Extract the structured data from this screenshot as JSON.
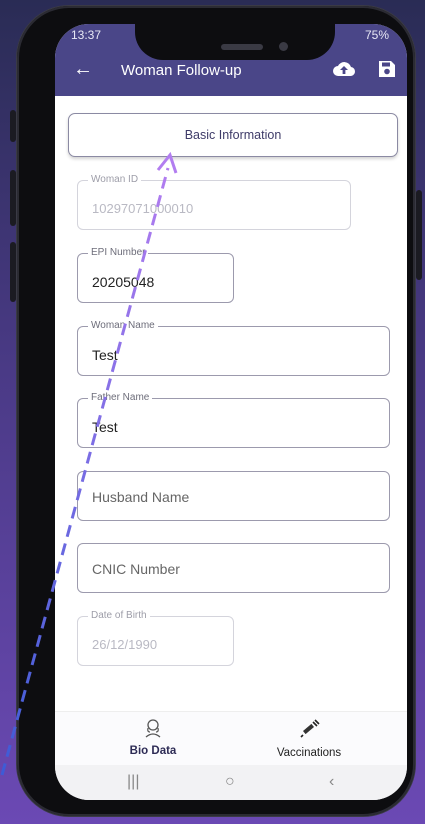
{
  "status_bar": {
    "time": "13:37",
    "battery": "75%"
  },
  "header": {
    "title": "Woman Follow-up"
  },
  "section_button": {
    "label": "Basic Information"
  },
  "fields": {
    "woman_id": {
      "label": "Woman ID",
      "value": "10297071000010",
      "disabled": true
    },
    "epi_number": {
      "label": "EPI Number",
      "value": "20205048"
    },
    "woman_name": {
      "label": "Woman Name",
      "value": "Test"
    },
    "father_name": {
      "label": "Father Name",
      "value": "Test"
    },
    "husband_name": {
      "placeholder": "Husband Name"
    },
    "cnic_number": {
      "placeholder": "CNIC Number"
    },
    "date_of_birth": {
      "label": "Date of Birth",
      "value": "26/12/1990",
      "disabled": true
    }
  },
  "bottom_nav": {
    "bio_data": {
      "label": "Bio Data",
      "icon": "woman-profile-icon",
      "active": true
    },
    "vaccinations": {
      "label": "Vaccinations",
      "icon": "syringe-icon"
    }
  },
  "colors": {
    "header": "#4a4688",
    "accent": "#3e3b68",
    "arrow_start": "#3d5bd6",
    "arrow_end": "#b27df0"
  }
}
